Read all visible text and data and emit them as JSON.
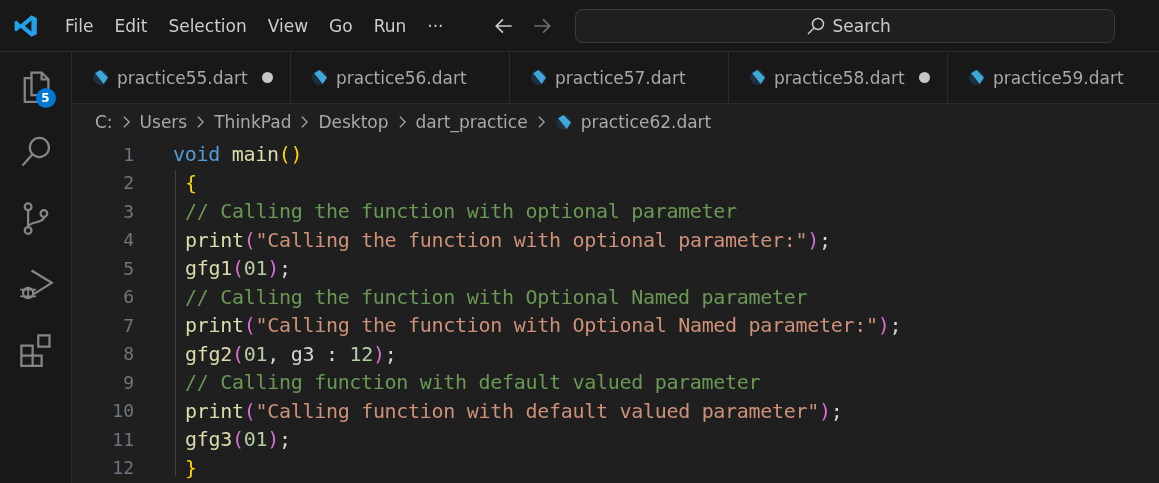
{
  "menu_bar": {
    "items": [
      "File",
      "Edit",
      "Selection",
      "View",
      "Go",
      "Run",
      "···"
    ]
  },
  "search": {
    "placeholder": "Search"
  },
  "activity_bar": {
    "explorer_badge": "5"
  },
  "tabs": [
    {
      "label": "practice55.dart",
      "modified": true
    },
    {
      "label": "practice56.dart",
      "modified": false
    },
    {
      "label": "practice57.dart",
      "modified": false
    },
    {
      "label": "practice58.dart",
      "modified": true
    },
    {
      "label": "practice59.dart",
      "modified": false
    }
  ],
  "breadcrumb": [
    "C:",
    "Users",
    "ThinkPad",
    "Desktop",
    "dart_practice",
    "practice62.dart"
  ],
  "editor": {
    "lines": [
      {
        "number": "1",
        "indented": false,
        "tokens": [
          {
            "kind": "keyword",
            "text": "void "
          },
          {
            "kind": "function",
            "text": "main"
          },
          {
            "kind": "bracket",
            "text": "()"
          }
        ]
      },
      {
        "number": "2",
        "indented": true,
        "tokens": [
          {
            "kind": "bracket",
            "text": "{"
          }
        ]
      },
      {
        "number": "3",
        "indented": true,
        "tokens": [
          {
            "kind": "comment",
            "text": "// Calling the function with optional parameter"
          }
        ]
      },
      {
        "number": "4",
        "indented": true,
        "tokens": [
          {
            "kind": "function",
            "text": "print"
          },
          {
            "kind": "bracket2",
            "text": "("
          },
          {
            "kind": "string",
            "text": "\"Calling the function with optional parameter:\""
          },
          {
            "kind": "bracket2",
            "text": ")"
          },
          {
            "kind": "plain",
            "text": ";"
          }
        ]
      },
      {
        "number": "5",
        "indented": true,
        "tokens": [
          {
            "kind": "function",
            "text": "gfg1"
          },
          {
            "kind": "bracket2",
            "text": "("
          },
          {
            "kind": "number",
            "text": "01"
          },
          {
            "kind": "bracket2",
            "text": ")"
          },
          {
            "kind": "plain",
            "text": ";"
          }
        ]
      },
      {
        "number": "6",
        "indented": true,
        "tokens": [
          {
            "kind": "comment",
            "text": "// Calling the function with Optional Named parameter"
          }
        ]
      },
      {
        "number": "7",
        "indented": true,
        "tokens": [
          {
            "kind": "function",
            "text": "print"
          },
          {
            "kind": "bracket2",
            "text": "("
          },
          {
            "kind": "string",
            "text": "\"Calling the function with Optional Named parameter:\""
          },
          {
            "kind": "bracket2",
            "text": ")"
          },
          {
            "kind": "plain",
            "text": ";"
          }
        ]
      },
      {
        "number": "8",
        "indented": true,
        "tokens": [
          {
            "kind": "function",
            "text": "gfg2"
          },
          {
            "kind": "bracket2",
            "text": "("
          },
          {
            "kind": "number",
            "text": "01"
          },
          {
            "kind": "plain",
            "text": ", g3 : "
          },
          {
            "kind": "number",
            "text": "12"
          },
          {
            "kind": "bracket2",
            "text": ")"
          },
          {
            "kind": "plain",
            "text": ";"
          }
        ]
      },
      {
        "number": "9",
        "indented": true,
        "tokens": [
          {
            "kind": "comment",
            "text": "// Calling function with default valued parameter"
          }
        ]
      },
      {
        "number": "10",
        "indented": true,
        "tokens": [
          {
            "kind": "function",
            "text": "print"
          },
          {
            "kind": "bracket2",
            "text": "("
          },
          {
            "kind": "string",
            "text": "\"Calling function with default valued parameter\""
          },
          {
            "kind": "bracket2",
            "text": ")"
          },
          {
            "kind": "plain",
            "text": ";"
          }
        ]
      },
      {
        "number": "11",
        "indented": true,
        "tokens": [
          {
            "kind": "function",
            "text": "gfg3"
          },
          {
            "kind": "bracket2",
            "text": "("
          },
          {
            "kind": "number",
            "text": "01"
          },
          {
            "kind": "bracket2",
            "text": ")"
          },
          {
            "kind": "plain",
            "text": ";"
          }
        ]
      },
      {
        "number": "12",
        "indented": true,
        "tokens": [
          {
            "kind": "bracket",
            "text": "}"
          }
        ]
      }
    ]
  }
}
